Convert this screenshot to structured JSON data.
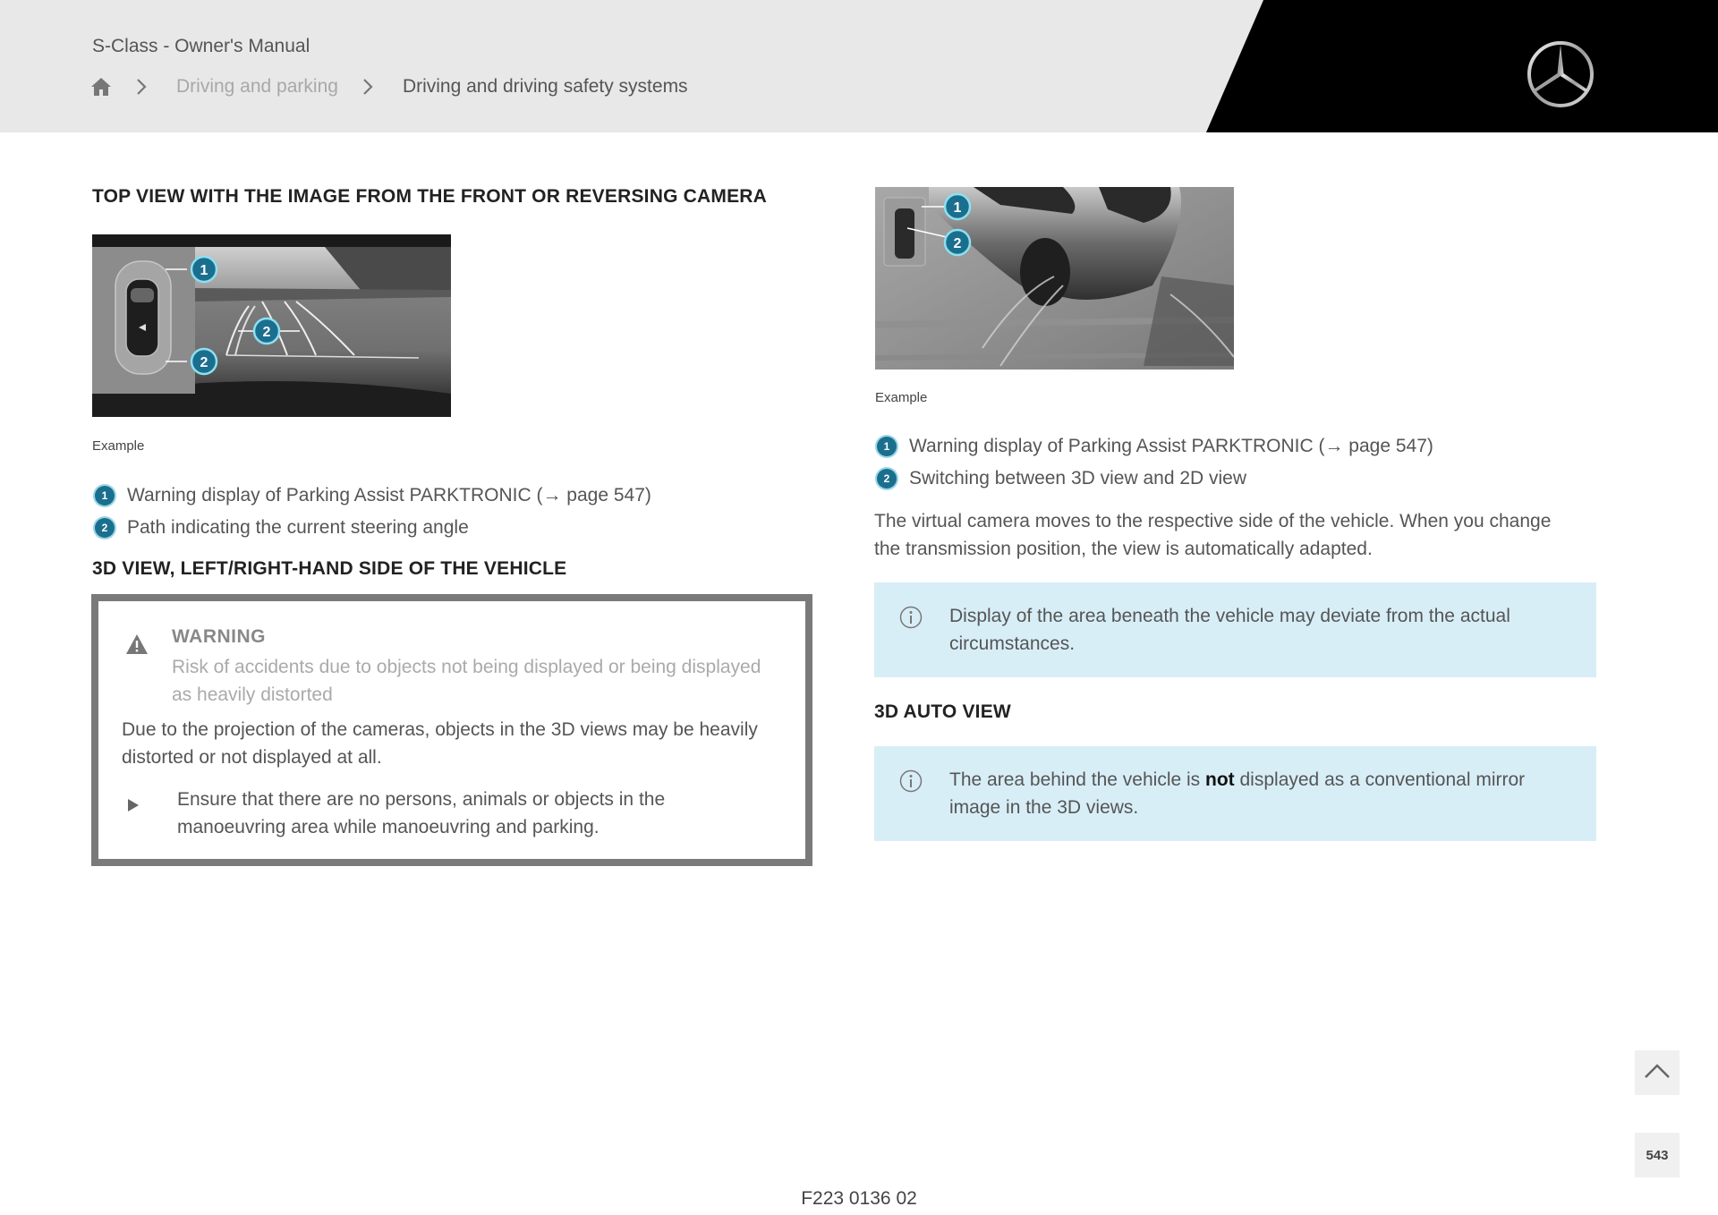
{
  "header": {
    "manual_title": "S-Class - Owner's Manual",
    "breadcrumb": [
      {
        "icon": "home-icon"
      },
      {
        "label": "Driving and parking"
      },
      {
        "label": "Driving and driving safety systems"
      }
    ],
    "logo": "mercedes-star-logo"
  },
  "left": {
    "section1_title": "TOP VIEW WITH THE IMAGE FROM THE FRONT OR REVERSING CAMERA",
    "figure_callouts": [
      "1",
      "2",
      "2"
    ],
    "caption": "Example",
    "legend": [
      {
        "num": "1",
        "text": "Warning display of Parking Assist PARKTRONIC (→ page 547)"
      },
      {
        "num": "2",
        "text": "Path indicating the current steering angle"
      }
    ],
    "section2_title": "3D VIEW, LEFT/RIGHT-HAND SIDE OF THE VEHICLE",
    "warning": {
      "title": "WARNING",
      "subtitle": "Risk of accidents due to objects not being displayed or being displayed as heavily distorted",
      "body": "Due to the projection of the cameras, objects in the 3D views may be heavily distorted or not displayed at all.",
      "step": "Ensure that there are no persons, animals or objects in the manoeuvring area while manoeuvring and parking."
    }
  },
  "right": {
    "figure_callouts": [
      "1",
      "2"
    ],
    "caption": "Example",
    "legend": [
      {
        "num": "1",
        "text": "Warning display of Parking Assist PARKTRONIC (→ page 547)"
      },
      {
        "num": "2",
        "text": "Switching between 3D view and 2D view"
      }
    ],
    "paragraph": "The virtual camera moves to the respective side of the vehicle. When you change the transmission position, the view is automatically adapted.",
    "info1": "Display of the area beneath the vehicle may deviate from the actual circumstances.",
    "section3_title": "3D AUTO VIEW",
    "info2": {
      "before": "The area behind the vehicle is ",
      "bold": "not",
      "after": " displayed as a conventional mirror image in the 3D views."
    }
  },
  "controls": {
    "scroll_top_icon": "chevron-up-icon",
    "page_number": "543"
  },
  "footer": {
    "code": "F223 0136 02"
  },
  "colors": {
    "header_bg": "#e8e8e8",
    "header_black": "#000000",
    "info_bg": "#d8eef7",
    "callout_teal": "#1b6f8e",
    "callout_ring": "#9ad6e6",
    "warning_border": "#7a7a7a"
  }
}
